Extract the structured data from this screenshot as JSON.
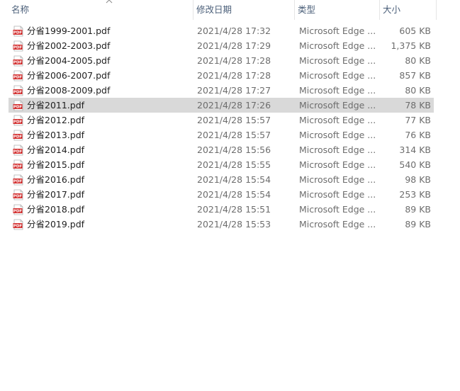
{
  "header": {
    "name": "名称",
    "date": "修改日期",
    "type": "类型",
    "size": "大小"
  },
  "files": [
    {
      "name": "分省1999-2001.pdf",
      "date": "2021/4/28 17:32",
      "type": "Microsoft Edge ...",
      "size": "605 KB"
    },
    {
      "name": "分省2002-2003.pdf",
      "date": "2021/4/28 17:29",
      "type": "Microsoft Edge ...",
      "size": "1,375 KB"
    },
    {
      "name": "分省2004-2005.pdf",
      "date": "2021/4/28 17:28",
      "type": "Microsoft Edge ...",
      "size": "80 KB"
    },
    {
      "name": "分省2006-2007.pdf",
      "date": "2021/4/28 17:28",
      "type": "Microsoft Edge ...",
      "size": "857 KB"
    },
    {
      "name": "分省2008-2009.pdf",
      "date": "2021/4/28 17:27",
      "type": "Microsoft Edge ...",
      "size": "80 KB"
    },
    {
      "name": "分省2011.pdf",
      "date": "2021/4/28 17:26",
      "type": "Microsoft Edge ...",
      "size": "78 KB",
      "selected": true
    },
    {
      "name": "分省2012.pdf",
      "date": "2021/4/28 15:57",
      "type": "Microsoft Edge ...",
      "size": "77 KB"
    },
    {
      "name": "分省2013.pdf",
      "date": "2021/4/28 15:57",
      "type": "Microsoft Edge ...",
      "size": "76 KB"
    },
    {
      "name": "分省2014.pdf",
      "date": "2021/4/28 15:56",
      "type": "Microsoft Edge ...",
      "size": "314 KB"
    },
    {
      "name": "分省2015.pdf",
      "date": "2021/4/28 15:55",
      "type": "Microsoft Edge ...",
      "size": "540 KB"
    },
    {
      "name": "分省2016.pdf",
      "date": "2021/4/28 15:54",
      "type": "Microsoft Edge ...",
      "size": "98 KB"
    },
    {
      "name": "分省2017.pdf",
      "date": "2021/4/28 15:54",
      "type": "Microsoft Edge ...",
      "size": "253 KB"
    },
    {
      "name": "分省2018.pdf",
      "date": "2021/4/28 15:51",
      "type": "Microsoft Edge ...",
      "size": "89 KB"
    },
    {
      "name": "分省2019.pdf",
      "date": "2021/4/28 15:53",
      "type": "Microsoft Edge ...",
      "size": "89 KB"
    }
  ],
  "icons": {
    "file_icon": "pdf-file-icon",
    "file_icon_label": "PDF",
    "sort_icon": "sort-ascending-icon"
  },
  "colors": {
    "header_text": "#4c607a",
    "selected_row": "#d9d9d9",
    "pdf_red": "#d32f2f"
  }
}
